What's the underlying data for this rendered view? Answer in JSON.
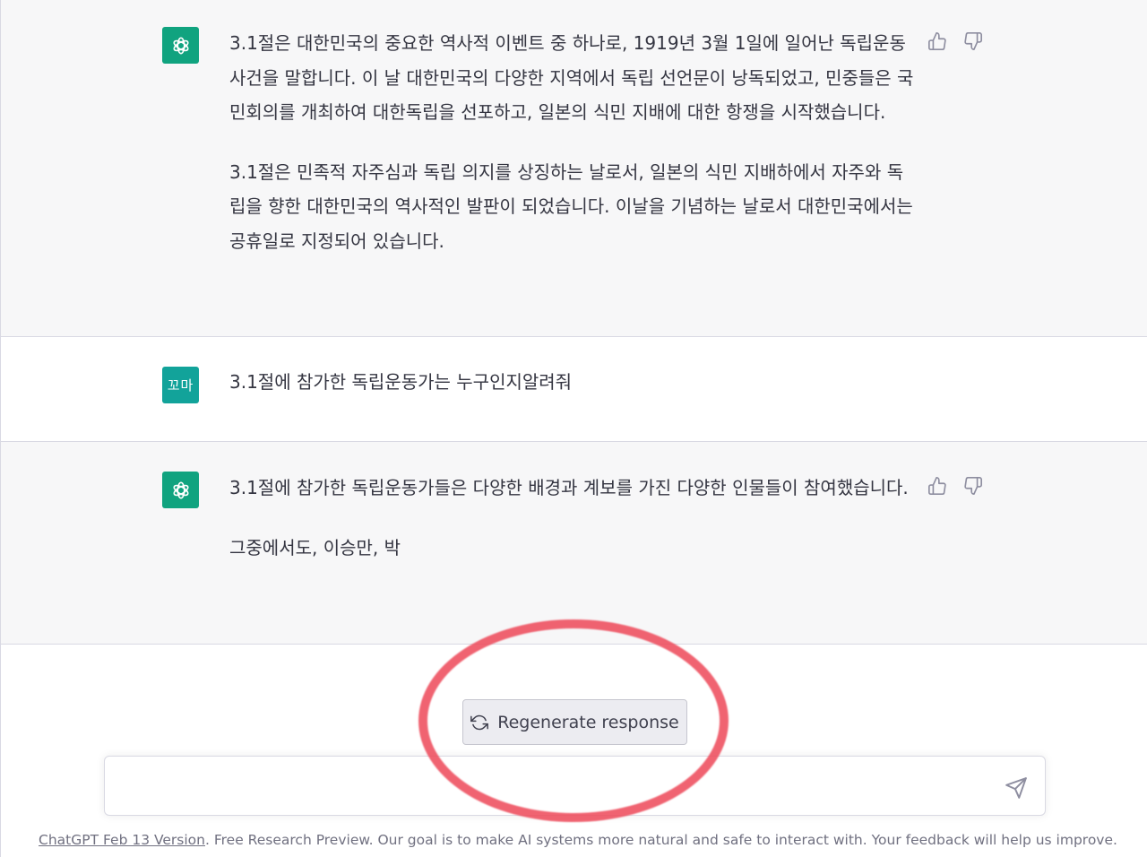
{
  "conversation": {
    "messages": [
      {
        "role": "assistant",
        "paragraphs": [
          "3.1절은 대한민국의 중요한 역사적 이벤트 중 하나로, 1919년 3월 1일에 일어난 독립운동 사건을 말합니다. 이 날 대한민국의 다양한 지역에서 독립 선언문이 낭독되었고, 민중들은 국민회의를 개최하여 대한독립을 선포하고, 일본의 식민 지배에 대한 항쟁을 시작했습니다.",
          "3.1절은 민족적 자주심과 독립 의지를 상징하는 날로서, 일본의 식민 지배하에서 자주와 독립을 향한 대한민국의 역사적인 발판이 되었습니다. 이날을 기념하는 날로서 대한민국에서는 공휴일로 지정되어 있습니다."
        ]
      },
      {
        "role": "user",
        "avatar_label": "꼬마",
        "text": "3.1절에 참가한 독립운동가는 누구인지알려줘"
      },
      {
        "role": "assistant",
        "paragraphs": [
          "3.1절에 참가한 독립운동가들은 다양한 배경과 계보를 가진 다양한 인물들이 참여했습니다.",
          "그중에서도, 이승만, 박"
        ]
      }
    ]
  },
  "controls": {
    "regenerate_label": "Regenerate response",
    "input_value": "",
    "input_placeholder": ""
  },
  "footer": {
    "version_link": "ChatGPT Feb 13 Version",
    "text": ". Free Research Preview. Our goal is to make AI systems more natural and safe to interact with. Your feedback will help us improve."
  },
  "icons": {
    "assistant_avatar": "openai-logo-icon",
    "thumbs_up": "thumbs-up-icon",
    "thumbs_down": "thumbs-down-icon",
    "regenerate": "refresh-icon",
    "send": "send-icon"
  },
  "colors": {
    "assistant_avatar_bg": "#10a37f",
    "user_avatar_bg": "#12a39a",
    "highlight_ring": "#ee4e5e"
  }
}
